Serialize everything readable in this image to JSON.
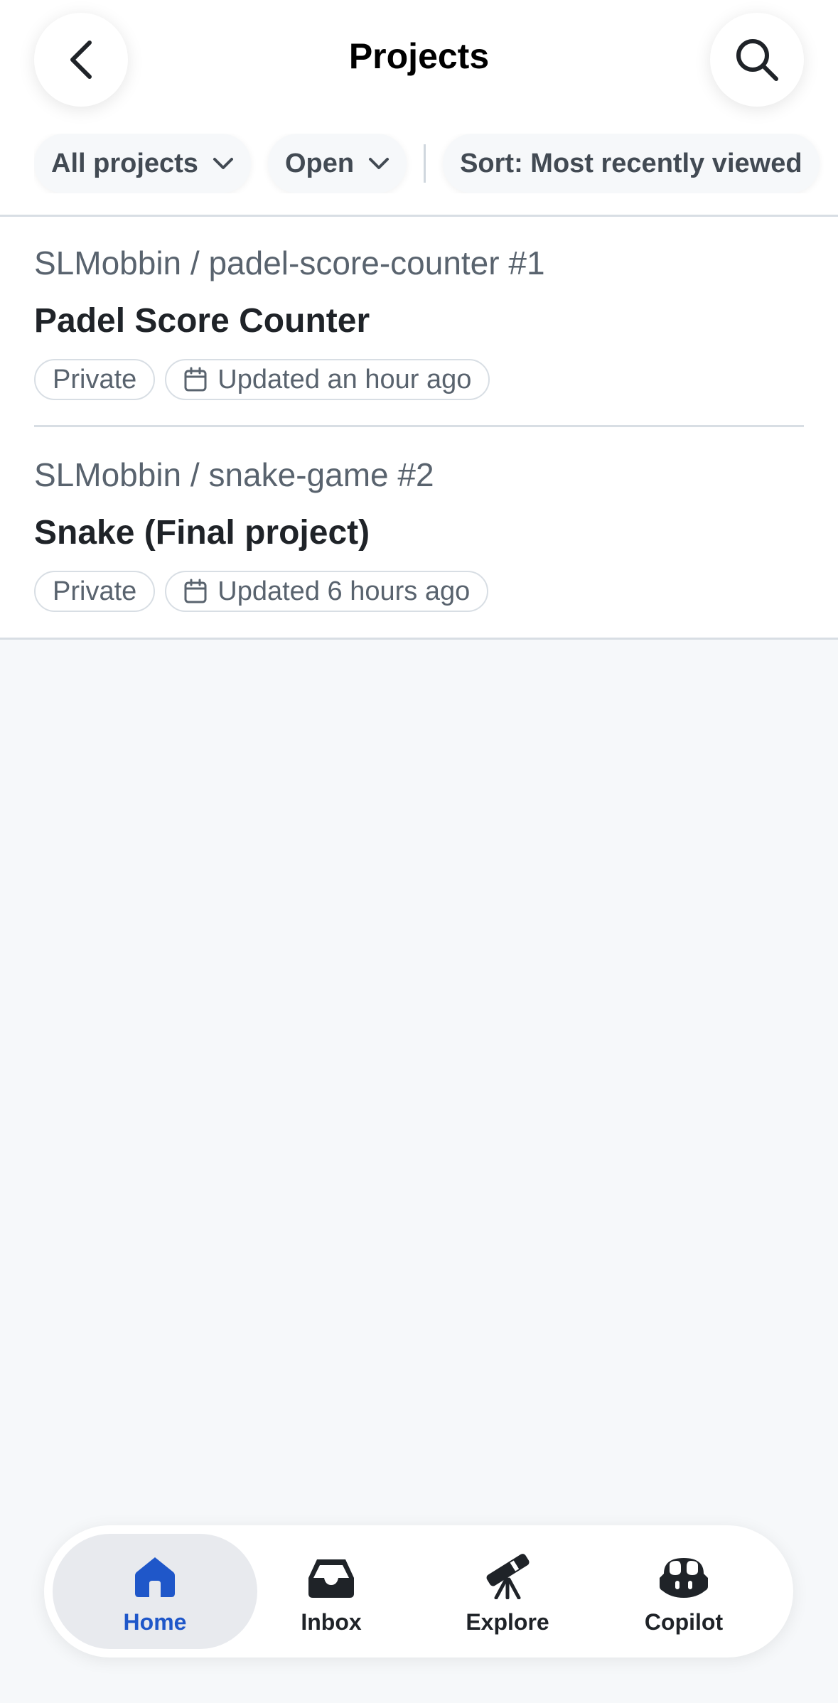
{
  "header": {
    "title": "Projects"
  },
  "filters": {
    "scope": "All projects",
    "state": "Open",
    "sort": "Sort: Most recently viewed"
  },
  "projects": [
    {
      "repo": "SLMobbin / padel-score-counter #1",
      "title": "Padel Score Counter",
      "visibility": "Private",
      "updated": "Updated an hour ago"
    },
    {
      "repo": "SLMobbin / snake-game #2",
      "title": "Snake (Final project)",
      "visibility": "Private",
      "updated": "Updated 6 hours ago"
    }
  ],
  "tabs": [
    {
      "label": "Home",
      "icon": "home-icon",
      "active": true
    },
    {
      "label": "Inbox",
      "icon": "inbox-icon",
      "active": false
    },
    {
      "label": "Explore",
      "icon": "telescope-icon",
      "active": false
    },
    {
      "label": "Copilot",
      "icon": "copilot-icon",
      "active": false
    }
  ],
  "colors": {
    "accent": "#1f57c9",
    "background": "#f6f8fa",
    "text": "#1f2328",
    "muted": "#59636e"
  }
}
